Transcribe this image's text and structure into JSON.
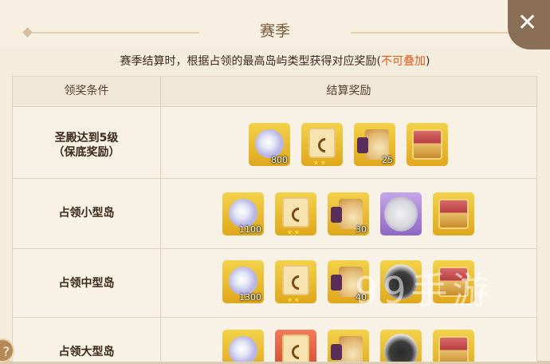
{
  "header": {
    "title": "赛季",
    "close_icon": "close-icon"
  },
  "description": {
    "text": "赛季结算时，根据占领的最高岛屿类型获得对应奖励",
    "warn_open": "(",
    "warn": "不可叠加",
    "warn_close": ")"
  },
  "table": {
    "col_condition": "领奖条件",
    "col_reward": "结算奖励",
    "rows": [
      {
        "condition_line1": "圣殿达到5级",
        "condition_line2": "（保底奖励）",
        "items": [
          {
            "icon": "crystal-icon",
            "frame": "gold",
            "qty": "800"
          },
          {
            "icon": "card-icon",
            "frame": "gold",
            "stars": "★★"
          },
          {
            "icon": "potion-icon",
            "frame": "gold",
            "qty": "25"
          },
          {
            "icon": "chest-icon",
            "frame": "gold"
          }
        ]
      },
      {
        "condition_line1": "占领小型岛",
        "items": [
          {
            "icon": "crystal-icon",
            "frame": "gold",
            "qty": "1100"
          },
          {
            "icon": "card-icon",
            "frame": "gold",
            "stars": "★★"
          },
          {
            "icon": "potion-icon",
            "frame": "gold",
            "qty": "30"
          },
          {
            "icon": "cloud-spirit-icon",
            "frame": "purple"
          },
          {
            "icon": "chest-icon",
            "frame": "gold"
          }
        ]
      },
      {
        "condition_line1": "占领中型岛",
        "items": [
          {
            "icon": "crystal-icon",
            "frame": "gold",
            "qty": "1300"
          },
          {
            "icon": "card-icon",
            "frame": "gold",
            "stars": "★★"
          },
          {
            "icon": "potion-icon",
            "frame": "gold",
            "qty": "40"
          },
          {
            "icon": "dark-spirit-icon",
            "frame": "gold"
          },
          {
            "icon": "chest-icon",
            "frame": "gold"
          }
        ]
      },
      {
        "condition_line1": "占领大型岛",
        "items": [
          {
            "icon": "crystal-icon",
            "frame": "gold"
          },
          {
            "icon": "card-icon",
            "frame": "red"
          },
          {
            "icon": "potion-icon",
            "frame": "gold"
          },
          {
            "icon": "dark-spirit-icon",
            "frame": "gold"
          },
          {
            "icon": "chest-icon",
            "frame": "gold"
          }
        ]
      }
    ]
  },
  "watermark": "99手游",
  "help_label": "?"
}
